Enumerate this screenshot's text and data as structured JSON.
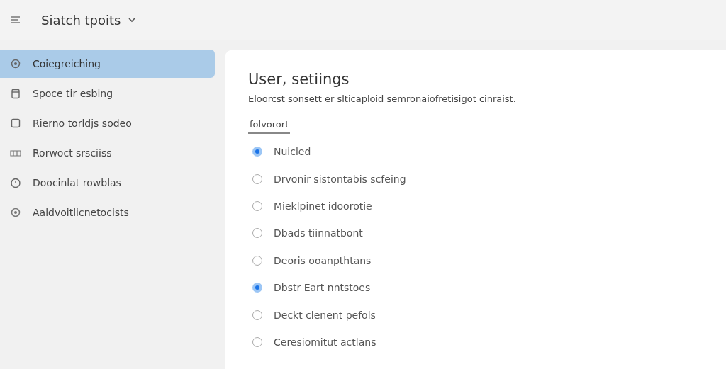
{
  "header": {
    "title": "Siatch tpoits"
  },
  "sidebar": {
    "items": [
      {
        "label": "Coiegreiching",
        "selected": true
      },
      {
        "label": "Spoce tir esbing",
        "selected": false
      },
      {
        "label": "Rierno torldjs sodeo",
        "selected": false
      },
      {
        "label": "Rorwoct srsciiss",
        "selected": false
      },
      {
        "label": "Doocinlat rowblas",
        "selected": false
      },
      {
        "label": "Aaldvoitlicnetocists",
        "selected": false
      }
    ]
  },
  "main": {
    "title": "User, setiings",
    "description": "Eloorcst sonsett er slticaploid semronaiofretisigot cinraist.",
    "tab": {
      "label": "folvorort",
      "selected": true
    },
    "options": [
      {
        "label": "Nuicled",
        "selected": true
      },
      {
        "label": "Drvonir sistontabis scfeing",
        "selected": false
      },
      {
        "label": "Mieklpinet idoorotie",
        "selected": false
      },
      {
        "label": "Dbads tiinnatbont",
        "selected": false
      },
      {
        "label": "Deoris ooanpthtans",
        "selected": false
      },
      {
        "label": "Dbstr Eart nntstoes",
        "selected": true
      },
      {
        "label": "Deckt clenent pefols",
        "selected": false
      },
      {
        "label": "Ceresiomitut actlans",
        "selected": false
      }
    ]
  }
}
